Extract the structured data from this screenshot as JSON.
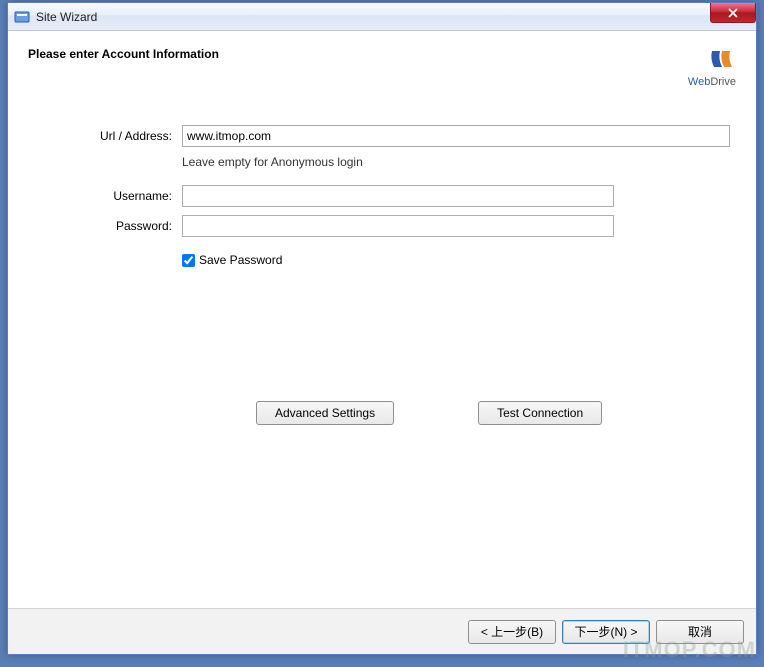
{
  "window": {
    "title": "Site Wizard"
  },
  "header": {
    "title": "Please enter Account Information"
  },
  "brand": {
    "web": "Web",
    "drive": "Drive"
  },
  "form": {
    "url_label": "Url / Address:",
    "url_value": "www.itmop.com",
    "url_hint": "Leave empty for Anonymous login",
    "username_label": "Username:",
    "username_value": "",
    "password_label": "Password:",
    "password_value": "",
    "save_password_label": "Save Password",
    "save_password_checked": true
  },
  "buttons": {
    "advanced": "Advanced Settings",
    "test": "Test Connection",
    "back": "< 上一步(B)",
    "next": "下一步(N) >",
    "cancel": "取消"
  },
  "watermark": "ITMOP.COM"
}
